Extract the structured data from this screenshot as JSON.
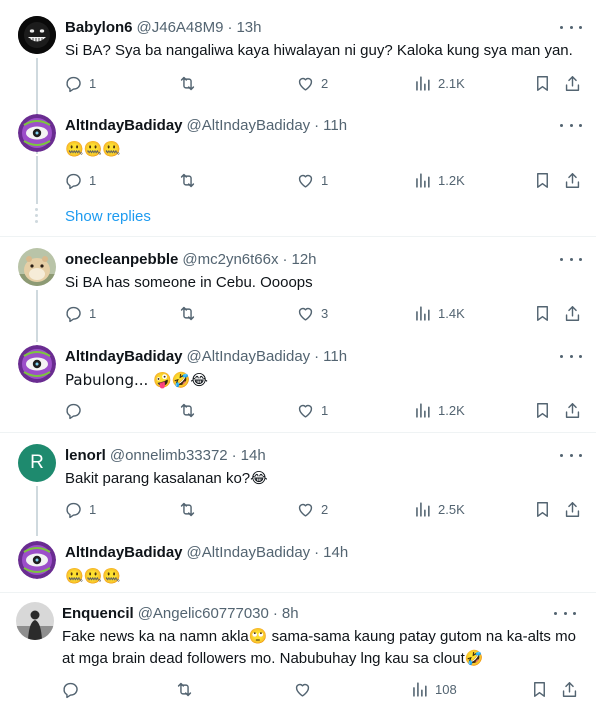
{
  "colors": {
    "text_primary": "#0f1419",
    "text_secondary": "#536471",
    "link": "#1d9bf0",
    "divider": "#eff3f4",
    "thread_line": "#cfd9de"
  },
  "tweets": [
    {
      "name": "Babylon6",
      "handle": "@J46A48M9",
      "time": "13h",
      "text": "Si BA? Sya ba nangaliwa kaya hiwalayan ni guy? Kaloka kung sya man yan.",
      "replies": "1",
      "retweets": "",
      "likes": "2",
      "views": "2.1K",
      "avatar": "grinning-dark-avatar"
    },
    {
      "name": "AltIndayBadiday",
      "handle": "@AltIndayBadiday",
      "time": "11h",
      "text": "🤐🤐🤐",
      "replies": "1",
      "retweets": "",
      "likes": "1",
      "views": "1.2K",
      "avatar": "eye-badge-avatar"
    },
    {
      "name": "onecleanpebble",
      "handle": "@mc2yn6t66x",
      "time": "12h",
      "text": "Si BA has someone in Cebu. Oooops",
      "replies": "1",
      "retweets": "",
      "likes": "3",
      "views": "1.4K",
      "avatar": "hamster-photo-avatar"
    },
    {
      "name": "AltIndayBadiday",
      "handle": "@AltIndayBadiday",
      "time": "11h",
      "text": "Pabulong... 🤪🤣😂",
      "replies": "",
      "retweets": "",
      "likes": "1",
      "views": "1.2K",
      "avatar": "eye-badge-avatar"
    },
    {
      "name": "lenorl",
      "handle": "@onnelimb33372",
      "time": "14h",
      "text": "Bakit parang kasalanan ko?😂",
      "replies": "1",
      "retweets": "",
      "likes": "2",
      "views": "2.5K",
      "avatar": "letter-avatar",
      "avatar_letter": "R"
    },
    {
      "name": "AltIndayBadiday",
      "handle": "@AltIndayBadiday",
      "time": "14h",
      "text": "🤐🤐🤐",
      "avatar": "eye-badge-avatar"
    },
    {
      "name": "Enquencil",
      "handle": "@Angelic60777030",
      "time": "8h",
      "text": "Fake news ka na namn akla🙄 sama-sama kaung patay gutom na ka-alts mo at mga brain dead followers mo. Nabubuhay lng kau sa clout🤣",
      "replies": "",
      "retweets": "",
      "likes": "",
      "views": "108",
      "avatar": "silhouette-photo-avatar"
    }
  ],
  "show_replies_label": "Show replies",
  "separator_dot": "·"
}
